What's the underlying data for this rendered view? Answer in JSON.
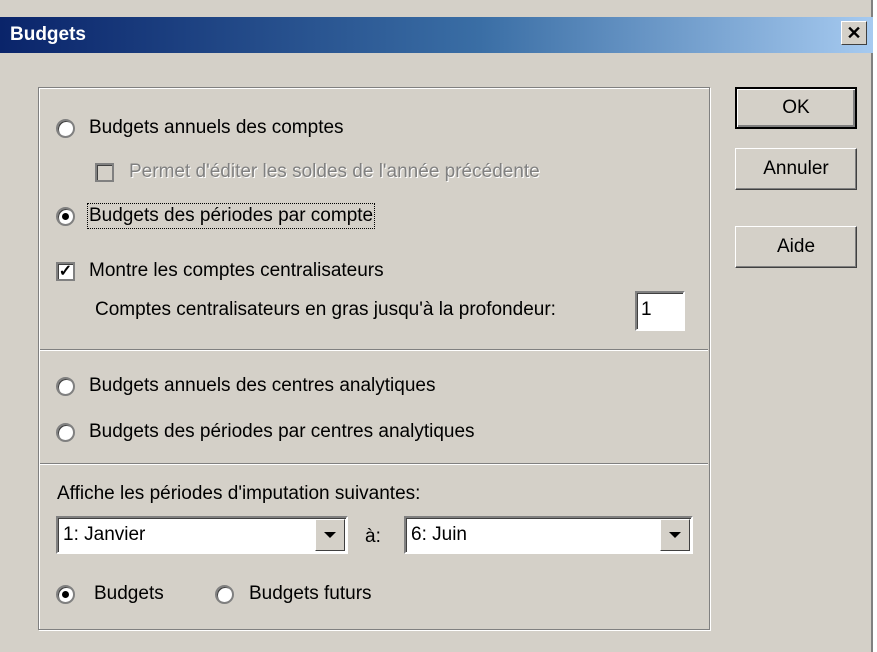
{
  "window": {
    "title": "Budgets",
    "close_glyph": "✕"
  },
  "options": {
    "annual_accounts": "Budgets annuels des comptes",
    "edit_previous_year": "Permet d'éditer les soldes de l'année précédente",
    "periods_per_account": "Budgets des périodes par compte",
    "show_central_accounts": "Montre les comptes centralisateurs",
    "central_bold_depth_label": "Comptes centralisateurs en gras jusqu'à la profondeur:",
    "central_bold_depth_value": "1",
    "annual_analytic_centres": "Budgets annuels des centres analytiques",
    "periods_per_analytic_centre": "Budgets des périodes par centres analytiques"
  },
  "periods": {
    "label": "Affiche les périodes d'imputation suivantes:",
    "from": "1: Janvier",
    "to_label": "à:",
    "to": "6: Juin",
    "budgets": "Budgets",
    "future_budgets": "Budgets futurs"
  },
  "buttons": {
    "ok": "OK",
    "cancel": "Annuler",
    "help": "Aide"
  },
  "state": {
    "selected_budget_type": "periods_per_account",
    "edit_previous_year_checked": false,
    "edit_previous_year_enabled": false,
    "show_central_accounts_checked": true,
    "selected_period_mode": "budgets"
  }
}
